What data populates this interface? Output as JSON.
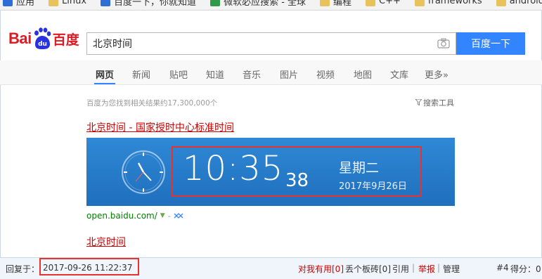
{
  "bookmarks": [
    {
      "label": "应用",
      "icon": "apps-icon"
    },
    {
      "label": "Linux",
      "icon": "folder-icon"
    },
    {
      "label": "百度一下，你就知道",
      "icon": "baidu-icon"
    },
    {
      "label": "微软必应搜索 - 全球",
      "icon": "bing-icon"
    },
    {
      "label": "编程",
      "icon": "folder-icon"
    },
    {
      "label": "C++",
      "icon": "folder-icon"
    },
    {
      "label": "frameworks",
      "icon": "folder-icon"
    },
    {
      "label": "android app",
      "icon": "folder-icon"
    }
  ],
  "logo": {
    "left": "Bai",
    "right": "百度"
  },
  "search": {
    "query": "北京时间",
    "button": "百度一下"
  },
  "tabs": [
    "网页",
    "新闻",
    "贴吧",
    "知道",
    "音乐",
    "图片",
    "视频",
    "地图",
    "文库",
    "更多»"
  ],
  "result_count": "百度为您找到相关结果约17,300,000个",
  "search_tools": "搜索工具",
  "result1": {
    "title": "北京时间 - 国家授时中心标准时间",
    "time_hm": "10:35",
    "time_sec": "38",
    "weekday": "星期二",
    "date": "2017年9月26日",
    "url": "open.baidu.com/"
  },
  "result2": {
    "title": "北京时间"
  },
  "footer": {
    "reply_label": "回复于：",
    "reply_time": "2017-09-26 11:22:37",
    "useful": "对我有用[0]",
    "brick": "丢个板砖[0]",
    "quote": "引用",
    "report": "举报",
    "manage": "管理",
    "floor": "#4",
    "score": "得分：0"
  },
  "colors": {
    "accent": "#3385ff",
    "red": "#cc0000",
    "highlight": "#e8322e",
    "card": "#2f89d6"
  }
}
